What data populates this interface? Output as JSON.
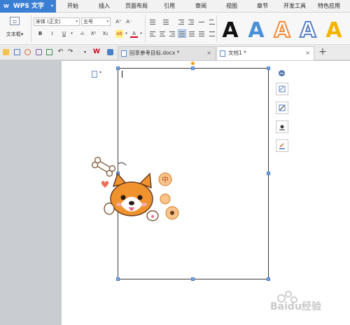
{
  "app": {
    "logo_text": "WPS 文字",
    "logo_mark": "W",
    "logo_dropdown": "▾"
  },
  "menu": {
    "items": [
      "开始",
      "插入",
      "页面布局",
      "引用",
      "审阅",
      "视图",
      "章节",
      "开发工具",
      "特色应用"
    ]
  },
  "ribbon": {
    "textbox_label": "文本框",
    "textbox_caret": "▾",
    "font_name": "宋体 (正文)",
    "font_size": "五号",
    "dropdown_arrow": "▾",
    "format_buttons": [
      "B",
      "I",
      "U",
      "X²",
      "X₂",
      "A"
    ],
    "grow_font": "A⁺",
    "shrink_font": "A⁻",
    "highlight_glyph": "ab",
    "font_color_glyph": "A",
    "text_style_gallery": [
      {
        "glyph": "A",
        "fill": "#111111",
        "outline": "none"
      },
      {
        "glyph": "A",
        "fill": "#4a90d9",
        "outline": "none"
      },
      {
        "glyph": "A",
        "fill": "#ffffff",
        "outline": "#ef8a3c"
      },
      {
        "glyph": "A",
        "fill": "#ffffff",
        "outline": "#5a7fc4"
      },
      {
        "glyph": "A",
        "fill": "#f3b400",
        "outline": "none"
      }
    ]
  },
  "toolbar": {
    "undo_glyph": "↶",
    "redo_glyph": "↷",
    "new_tab": "+"
  },
  "tabs": [
    {
      "label": "回享参考目标.docx *",
      "active": false,
      "close": "×"
    },
    {
      "label": "文档1 *",
      "active": true,
      "close": "×"
    }
  ],
  "document": {
    "watermark": "Baidu经验"
  },
  "colors": {
    "accent": "#3b7fd4",
    "ribbon_bg": "#f7f7f7",
    "workspace_bg": "#c9ccd1",
    "handle": "#7aa6e0"
  }
}
